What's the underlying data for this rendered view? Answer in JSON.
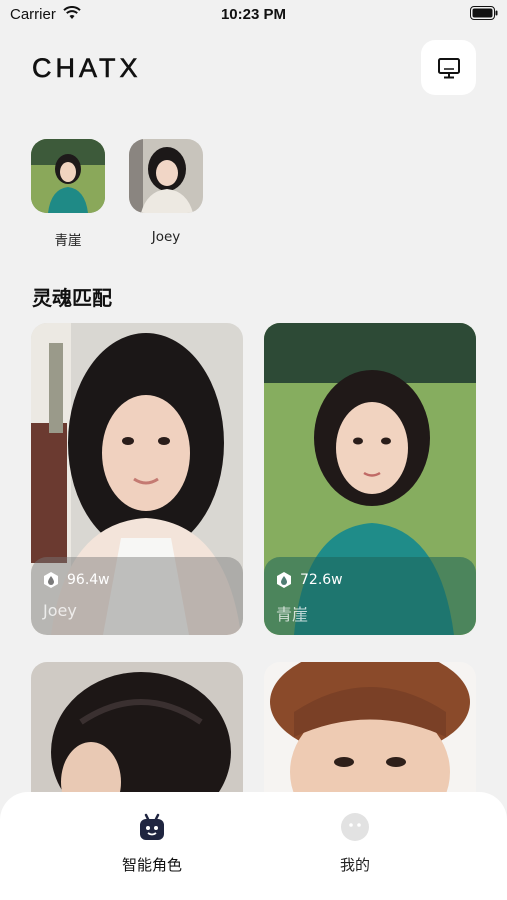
{
  "status_bar": {
    "carrier": "Carrier",
    "time": "10:23 PM"
  },
  "header": {
    "logo": "CHATX",
    "screen_icon": "monitor-icon"
  },
  "recent": [
    {
      "name": "青崖"
    },
    {
      "name": "Joey"
    }
  ],
  "section": {
    "title": "灵魂匹配"
  },
  "cards": [
    {
      "views": "96.4w",
      "name": "Joey"
    },
    {
      "views": "72.6w",
      "name": "青崖"
    }
  ],
  "tabs": [
    {
      "label": "智能角色",
      "icon": "robot-icon",
      "active": true
    },
    {
      "label": "我的",
      "icon": "face-icon",
      "active": false
    }
  ],
  "colors": {
    "background": "#f1f1f1",
    "active_icon": "#1f2540",
    "inactive_icon": "#e0e0e0"
  }
}
